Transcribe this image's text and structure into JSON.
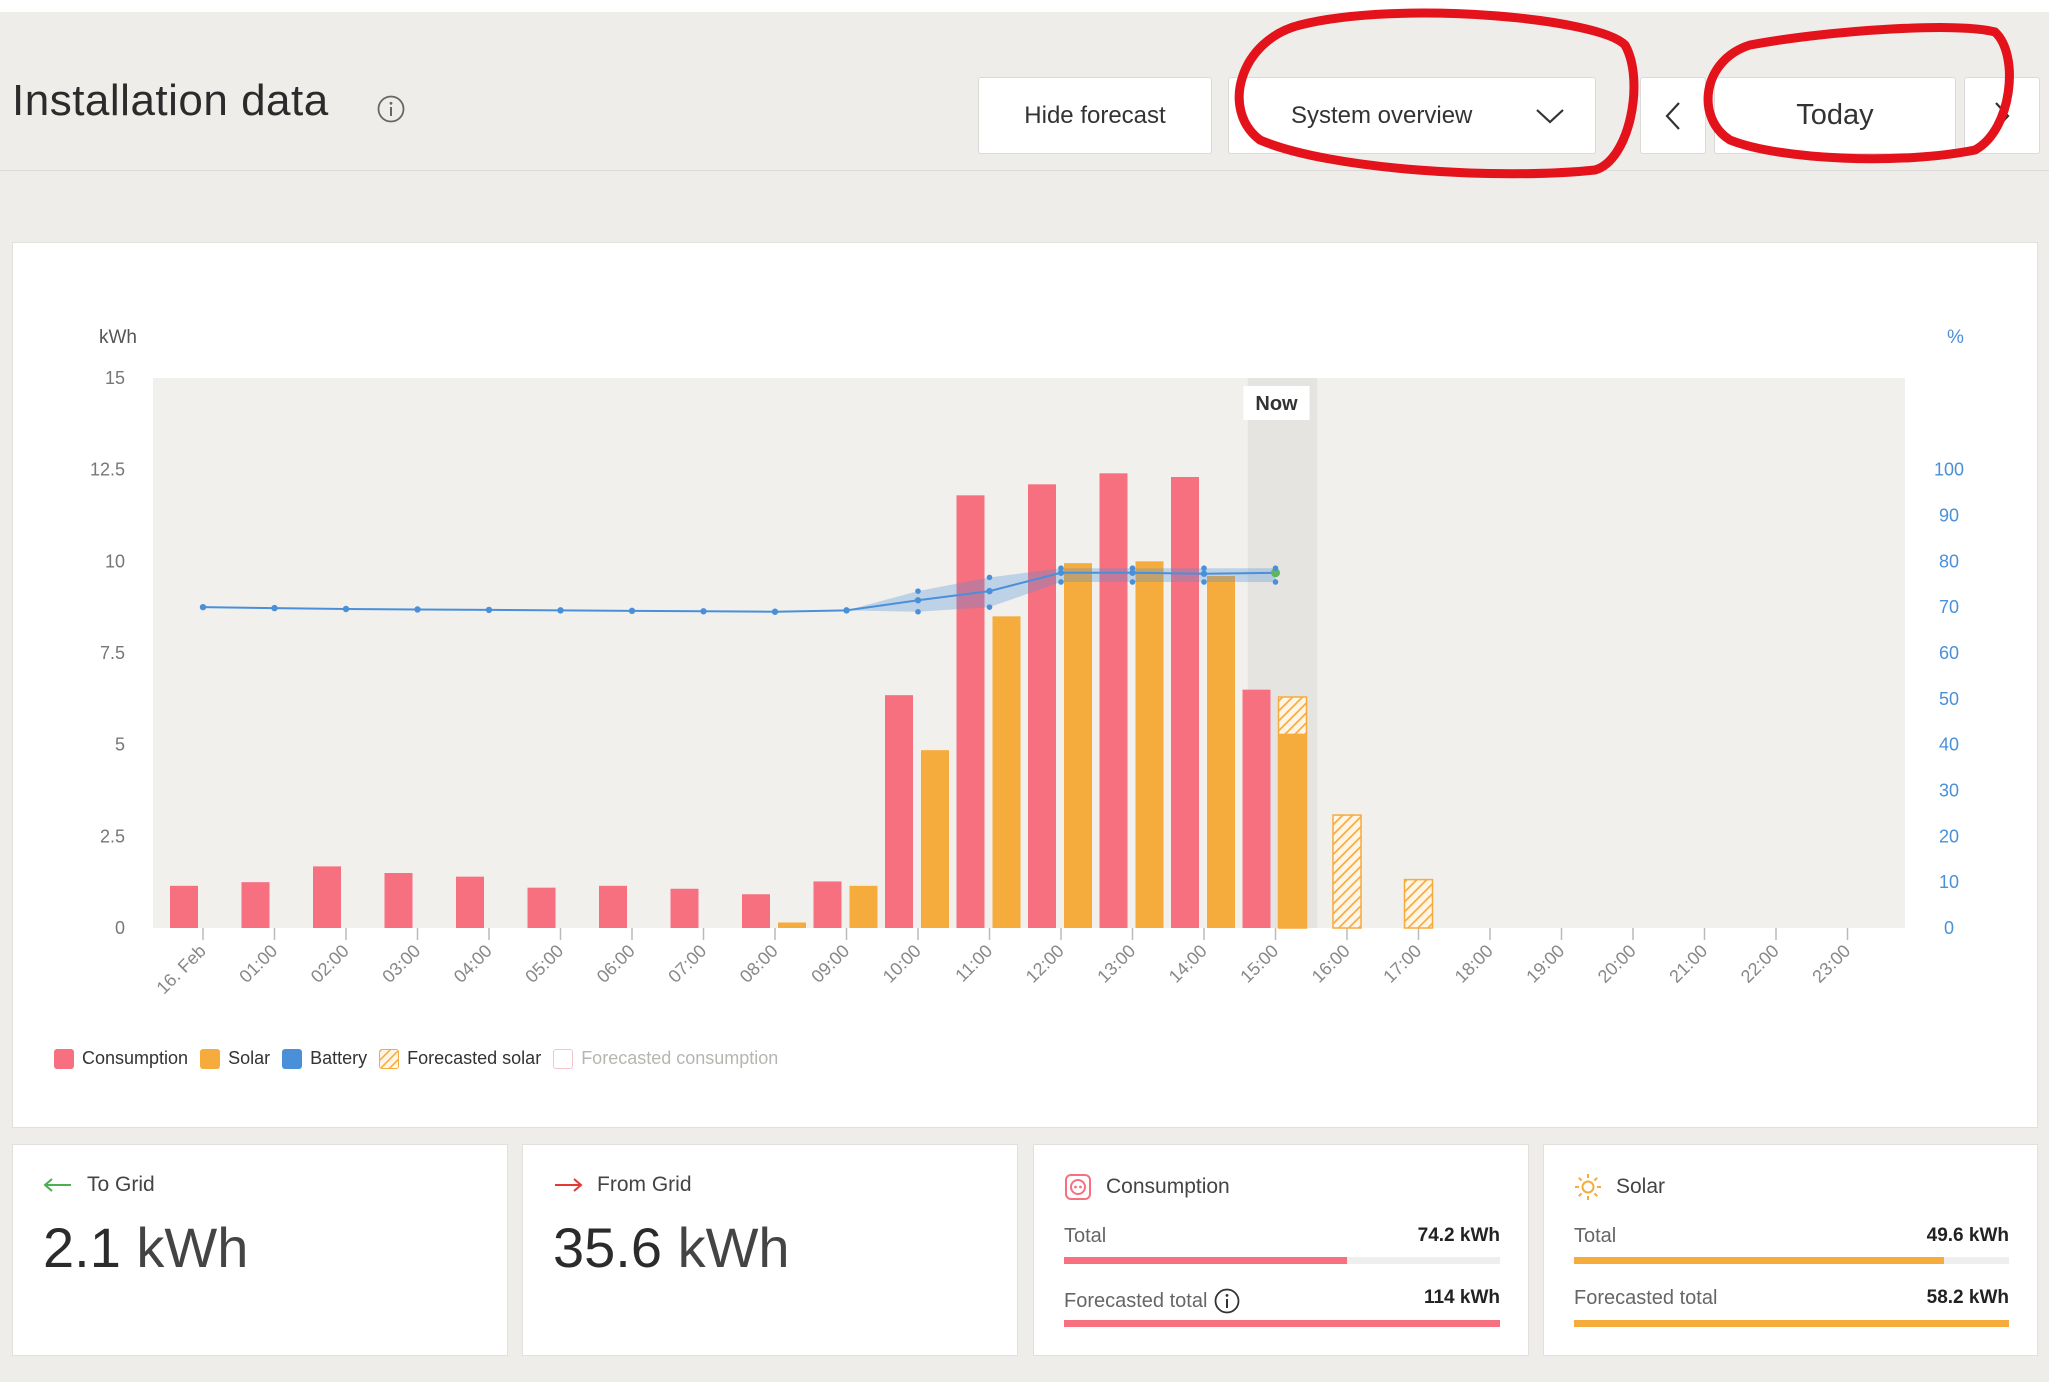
{
  "header": {
    "title": "Installation data",
    "hide_forecast_label": "Hide forecast",
    "view_select_value": "System overview",
    "date_label": "Today"
  },
  "colors": {
    "consumption": "#f6707f",
    "solar": "#f6ab3d",
    "battery": "#4a90d9",
    "to_grid_arrow": "#4caf50",
    "from_grid_arrow": "#e53935",
    "annotation_circle": "#e3121b"
  },
  "chart_data": {
    "type": "bar",
    "left_axis_label": "kWh",
    "right_axis_label": "%",
    "left_ticks": [
      "0",
      "2.5",
      "5",
      "7.5",
      "10",
      "12.5",
      "15"
    ],
    "left_ylim": [
      0,
      15
    ],
    "right_ticks": [
      "0",
      "10",
      "20",
      "30",
      "40",
      "50",
      "60",
      "70",
      "80",
      "90",
      "100"
    ],
    "right_ylim": [
      0,
      120
    ],
    "categories": [
      "16. Feb",
      "01:00",
      "02:00",
      "03:00",
      "04:00",
      "05:00",
      "06:00",
      "07:00",
      "08:00",
      "09:00",
      "10:00",
      "11:00",
      "12:00",
      "13:00",
      "14:00",
      "15:00",
      "16:00",
      "17:00",
      "18:00",
      "19:00",
      "20:00",
      "21:00",
      "22:00",
      "23:00"
    ],
    "now_label": "Now",
    "now_index": 15,
    "series": [
      {
        "name": "Consumption",
        "values": [
          1.15,
          1.25,
          1.68,
          1.5,
          1.4,
          1.1,
          1.15,
          1.07,
          0.92,
          1.27,
          6.35,
          11.8,
          12.1,
          12.4,
          12.3,
          6.5,
          null,
          null,
          null,
          null,
          null,
          null,
          null,
          null
        ]
      },
      {
        "name": "Solar",
        "values": [
          null,
          null,
          null,
          null,
          null,
          null,
          null,
          null,
          0.15,
          1.15,
          4.85,
          8.5,
          9.95,
          10.0,
          9.6,
          5.3,
          null,
          null,
          null,
          null,
          null,
          null,
          null,
          null
        ]
      },
      {
        "name": "Forecasted solar",
        "values": [
          null,
          null,
          null,
          null,
          null,
          null,
          null,
          null,
          null,
          null,
          null,
          null,
          null,
          null,
          null,
          6.3,
          3.08,
          1.32,
          null,
          null,
          null,
          null,
          null,
          null
        ]
      },
      {
        "name": "Battery",
        "values": [
          70,
          69.8,
          69.6,
          69.5,
          69.4,
          69.3,
          69.2,
          69.1,
          69.0,
          69.3,
          71.5,
          73.5,
          77.5,
          77.5,
          77.3,
          77.5,
          null,
          null,
          null,
          null,
          null,
          null,
          null,
          null
        ],
        "band_low": [
          null,
          null,
          null,
          null,
          null,
          null,
          null,
          null,
          null,
          69.3,
          69.0,
          70.0,
          75.5,
          75.5,
          75.5,
          75.5,
          null,
          null,
          null,
          null,
          null,
          null,
          null,
          null
        ],
        "band_high": [
          null,
          null,
          null,
          null,
          null,
          null,
          null,
          null,
          null,
          69.3,
          73.5,
          76.5,
          78.5,
          78.5,
          78.5,
          78.5,
          null,
          null,
          null,
          null,
          null,
          null,
          null,
          null
        ]
      }
    ],
    "legend": [
      "Consumption",
      "Solar",
      "Battery",
      "Forecasted solar",
      "Forecasted consumption"
    ],
    "legend_position": "bottom-left"
  },
  "summary": {
    "to_grid": {
      "title": "To Grid",
      "value": "2.1",
      "unit": "kWh"
    },
    "from_grid": {
      "title": "From Grid",
      "value": "35.6",
      "unit": "kWh"
    },
    "consumption": {
      "title": "Consumption",
      "total_label": "Total",
      "total_value": "74.2 kWh",
      "total_fraction": 0.65,
      "forecast_label": "Forecasted total",
      "forecast_value": "114 kWh",
      "forecast_fraction": 1.0
    },
    "solar": {
      "title": "Solar",
      "total_label": "Total",
      "total_value": "49.6 kWh",
      "total_fraction": 0.85,
      "forecast_label": "Forecasted total",
      "forecast_value": "58.2 kWh",
      "forecast_fraction": 1.0
    }
  }
}
